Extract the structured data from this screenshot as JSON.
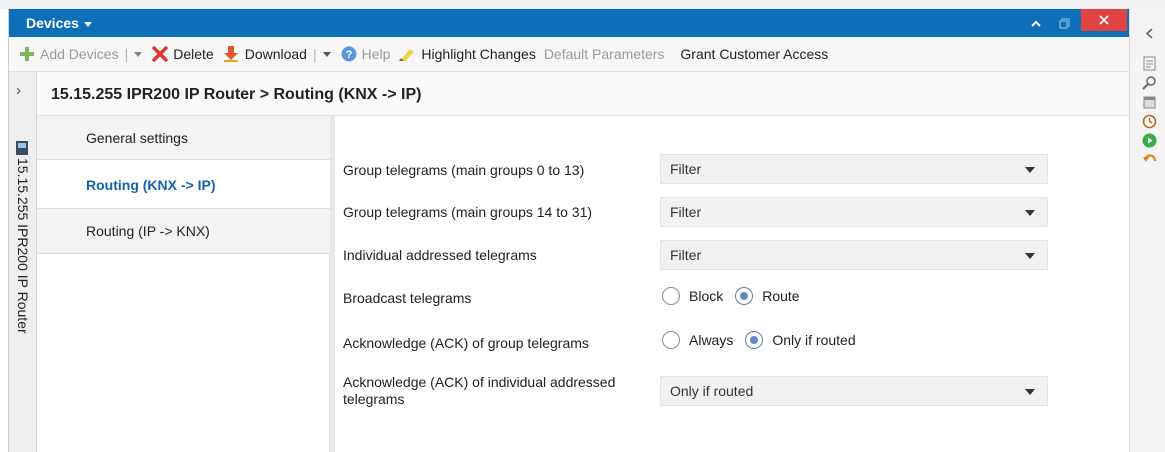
{
  "window": {
    "title": "Devices",
    "accent": "#0d6fb8",
    "close_color": "#e04343"
  },
  "toolbar": {
    "add_devices": "Add Devices",
    "delete": "Delete",
    "download": "Download",
    "help": "Help",
    "highlight_changes": "Highlight Changes",
    "default_parameters": "Default Parameters",
    "grant_customer_access": "Grant Customer Access"
  },
  "side_tab": {
    "device_label": "15.15.255 IPR200 IP Router"
  },
  "header": {
    "title": "15.15.255 IPR200 IP Router > Routing (KNX -> IP)"
  },
  "nav": {
    "items": [
      {
        "label": "General settings",
        "active": false
      },
      {
        "label": "Routing (KNX -> IP)",
        "active": true
      },
      {
        "label": "Routing (IP -> KNX)",
        "active": false
      }
    ]
  },
  "params": {
    "group_main_0_13": {
      "label": "Group telegrams (main groups 0 to 13)",
      "value": "Filter"
    },
    "group_main_14_31": {
      "label": "Group telegrams (main groups 14 to 31)",
      "value": "Filter"
    },
    "individual": {
      "label": "Individual addressed telegrams",
      "value": "Filter"
    },
    "broadcast": {
      "label": "Broadcast telegrams",
      "options": [
        "Block",
        "Route"
      ],
      "selected": "Route"
    },
    "ack_group": {
      "label": "Acknowledge (ACK) of group telegrams",
      "options": [
        "Always",
        "Only if routed"
      ],
      "selected": "Only if routed"
    },
    "ack_individual": {
      "label_line1": "Acknowledge (ACK) of individual addressed",
      "label_line2": "telegrams",
      "value": "Only if routed"
    }
  },
  "icons": {
    "add": "plus-icon",
    "delete": "x-icon",
    "download": "download-arrow-icon",
    "help": "help-icon",
    "highlight": "highlighter-icon"
  }
}
